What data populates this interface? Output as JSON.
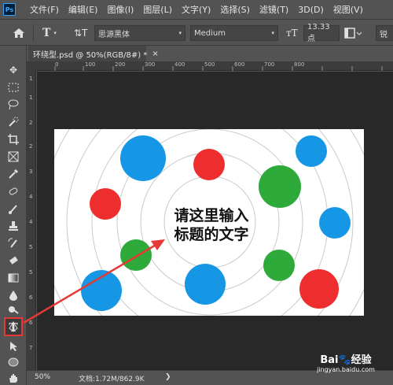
{
  "app": {
    "logo": "Ps"
  },
  "menu": [
    "文件(F)",
    "编辑(E)",
    "图像(I)",
    "图层(L)",
    "文字(Y)",
    "选择(S)",
    "滤镜(T)",
    "3D(D)",
    "视图(V)"
  ],
  "options": {
    "font_family": "思源黑体",
    "font_style": "Medium",
    "font_size": "13.33 点",
    "cut_label": "锐"
  },
  "tab": {
    "title": "环绕型.psd @ 50%(RGB/8#) *",
    "close": "×"
  },
  "ruler_h_ticks": [
    "0",
    "100",
    "200",
    "300",
    "400",
    "500",
    "600",
    "700",
    "800"
  ],
  "ruler_v_ticks": [
    "1",
    "1",
    "2",
    "2",
    "3",
    "4",
    "4",
    "5",
    "5",
    "6",
    "6",
    "7"
  ],
  "canvas": {
    "headline_line1": "请这里输入",
    "headline_line2": "标题的文字",
    "colors": {
      "blue": "#1597e5",
      "red": "#ee2e2e",
      "green": "#2daa3a",
      "ring": "#c9c9c9"
    }
  },
  "annotation": {
    "color": "#e53935"
  },
  "status": {
    "zoom": "50%",
    "doc": "文档:1.72M/862.9K",
    "arrow": "❯"
  },
  "watermark": {
    "brand": "Bai🐾经验",
    "url": "jingyan.baidu.com"
  }
}
